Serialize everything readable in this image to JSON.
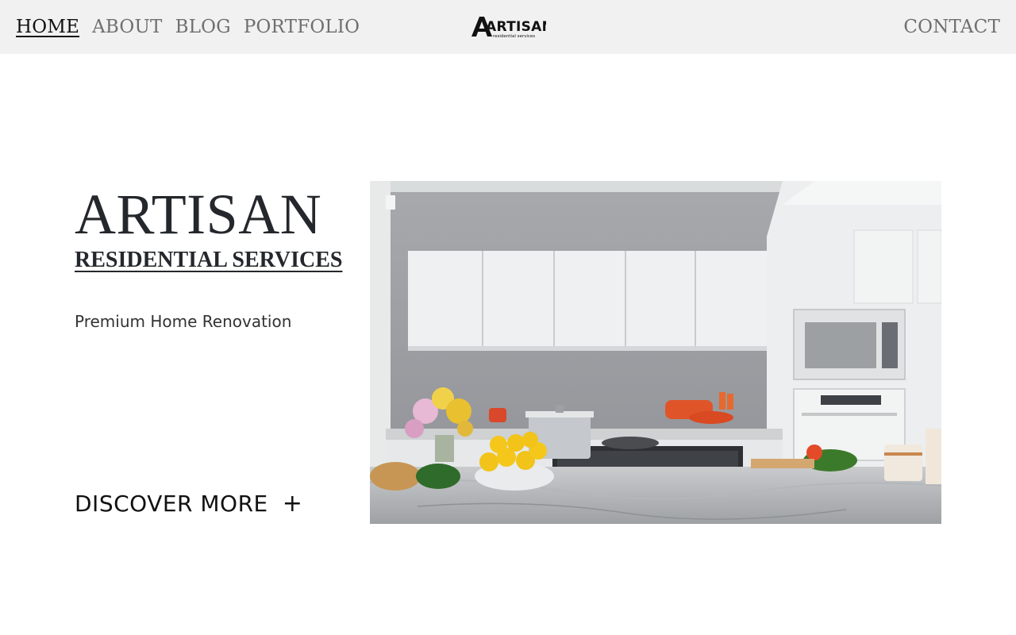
{
  "nav": {
    "items": [
      {
        "label": "HOME",
        "active": true
      },
      {
        "label": "ABOUT",
        "active": false
      },
      {
        "label": "BLOG",
        "active": false
      },
      {
        "label": "PORTFOLIO",
        "active": false
      }
    ],
    "contact_label": "CONTACT"
  },
  "logo": {
    "brand": "ARTISAN",
    "tagline": "residential services"
  },
  "hero": {
    "title": "ARTISAN",
    "subtitle": "RESIDENTIAL SERVICES",
    "tagline": "Premium Home Renovation",
    "cta_label": "DISCOVER MORE",
    "cta_icon": "plus-icon"
  },
  "colors": {
    "header_bg": "#f1f1f1",
    "text_dark": "#24272b",
    "nav_muted": "#6f6f6f"
  }
}
